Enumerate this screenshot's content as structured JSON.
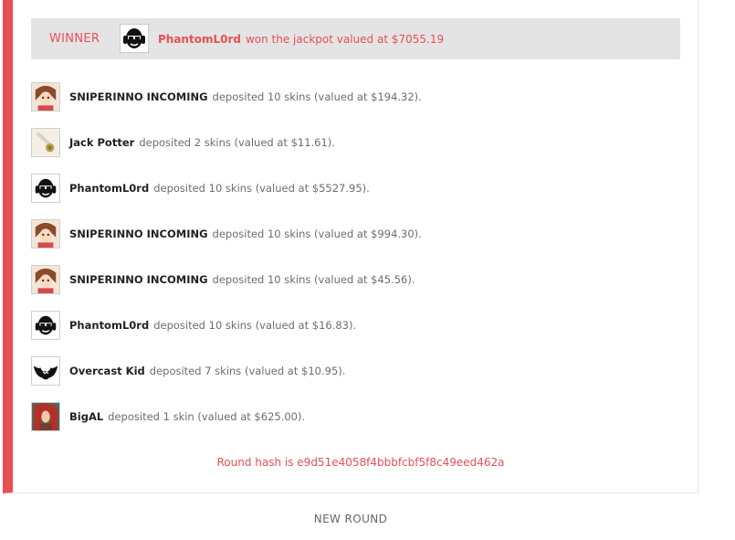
{
  "winner": {
    "label": "WINNER",
    "name": "PhantomL0rd",
    "message": "won the jackpot valued at $7055.19"
  },
  "deposits": [
    {
      "name": "SNIPERINNO INCOMING",
      "message": "deposited 10 skins (valued at $194.32).",
      "avatar": "anime-girl"
    },
    {
      "name": "Jack Potter",
      "message": "deposited 2 skins (valued at $11.61).",
      "avatar": "knife"
    },
    {
      "name": "PhantomL0rd",
      "message": "deposited 10 skins (valued at $5527.95).",
      "avatar": "headphones-face"
    },
    {
      "name": "SNIPERINNO INCOMING",
      "message": "deposited 10 skins (valued at $994.30).",
      "avatar": "anime-girl"
    },
    {
      "name": "SNIPERINNO INCOMING",
      "message": "deposited 10 skins (valued at $45.56).",
      "avatar": "anime-girl"
    },
    {
      "name": "PhantomL0rd",
      "message": "deposited 10 skins (valued at $16.83).",
      "avatar": "headphones-face"
    },
    {
      "name": "Overcast Kid",
      "message": "deposited 7 skins (valued at $10.95).",
      "avatar": "bat-wings"
    },
    {
      "name": "BigAL",
      "message": "deposited 1 skin (valued at $625.00).",
      "avatar": "red-hair-warrior"
    }
  ],
  "round_hash": "Round hash is e9d51e4058f4bbbfcbf5f8c49eed462a",
  "new_round_label": "NEW ROUND",
  "colors": {
    "accent": "#e94f52",
    "winner_bg": "#e4e4e4"
  }
}
